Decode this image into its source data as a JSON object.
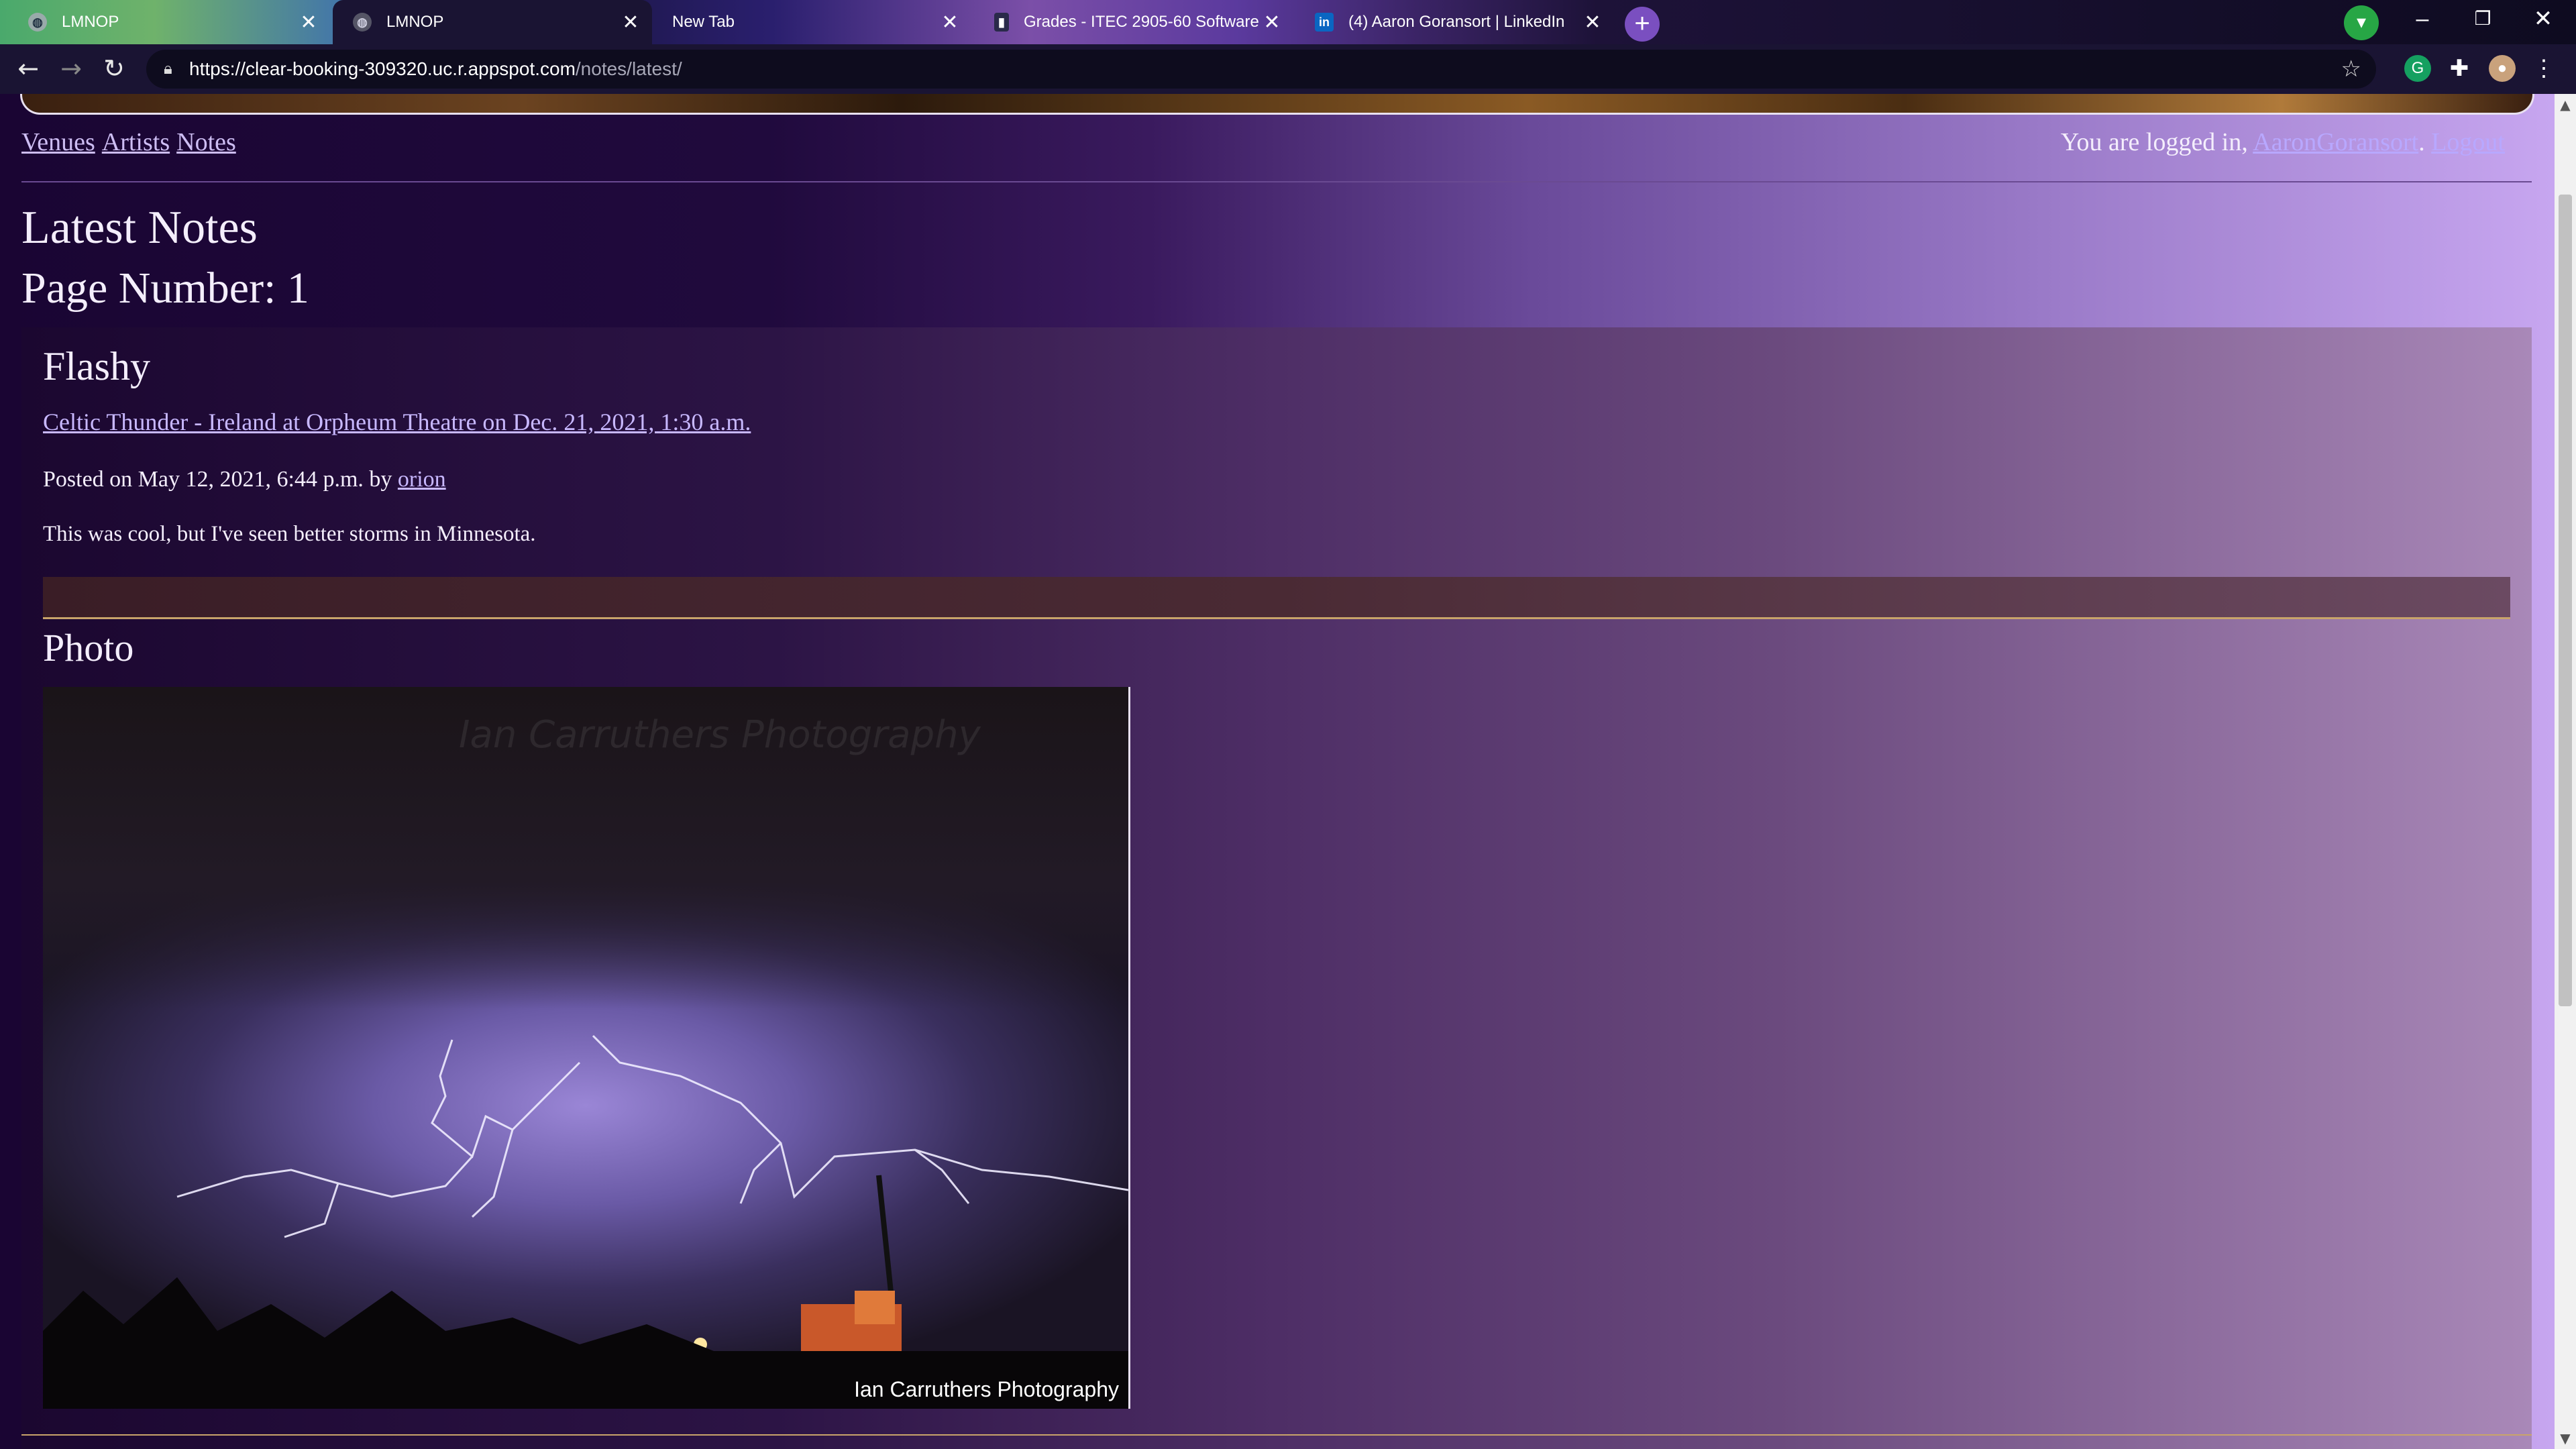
{
  "browser": {
    "tabs": [
      {
        "title": "LMNOP",
        "favicon": "globe-icon"
      },
      {
        "title": "LMNOP",
        "favicon": "globe-icon"
      },
      {
        "title": "New Tab",
        "favicon": ""
      },
      {
        "title": "Grades - ITEC 2905-60 Software",
        "favicon": "d2l-icon"
      },
      {
        "title": "(4) Aaron Goransort | LinkedIn",
        "favicon": "linkedin-icon"
      }
    ],
    "close_glyph": "✕",
    "new_tab_glyph": "+",
    "url_host": "https://clear-booking-309320.uc.r.appspot.com",
    "url_path": "/notes/latest/",
    "window_controls": {
      "minimize": "–",
      "restore": "❐",
      "close": "✕"
    }
  },
  "site": {
    "nav": {
      "venues": "Venues",
      "artists": "Artists",
      "notes": "Notes"
    },
    "login_text": "You are logged in, ",
    "login_user": "AaronGoransort",
    "login_sep": ".",
    "logout": "Logout"
  },
  "page": {
    "heading": "Latest Notes",
    "page_number": "Page Number: 1"
  },
  "note": {
    "title": "Flashy",
    "show_link": "Celtic Thunder - Ireland at Orpheum Theatre on Dec. 21, 2021, 1:30 a.m.",
    "posted_prefix": "Posted on May 12, 2021, 6:44 p.m. by ",
    "posted_by": "orion",
    "text": "This was cool, but I've seen better storms in Minnesota.",
    "photo_heading": "Photo",
    "photo_caption": "Ian Carruthers Photography",
    "photo_watermark": "Ian Carruthers Photography"
  }
}
